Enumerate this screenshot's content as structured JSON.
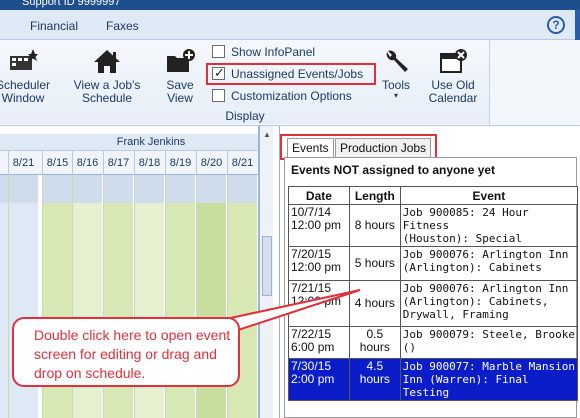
{
  "window": {
    "title": "Support ID 9999997"
  },
  "menu": {
    "items": [
      "Financial",
      "Faxes"
    ]
  },
  "ribbon": {
    "buttons": [
      {
        "label": "Scheduler\nWindow",
        "icon": "scheduler-icon"
      },
      {
        "label": "View a Job's\nSchedule",
        "icon": "house-icon"
      },
      {
        "label": "Save\nView",
        "icon": "save-view-icon"
      },
      {
        "label": "Tools",
        "icon": "wrench-icon"
      },
      {
        "label": "Use Old\nCalendar",
        "icon": "old-calendar-icon"
      }
    ],
    "options": [
      {
        "label": "Show InfoPanel",
        "checked": false
      },
      {
        "label": "Unassigned Events/Jobs",
        "checked": true
      },
      {
        "label": "Customization Options",
        "checked": false
      }
    ],
    "group_label": "Display"
  },
  "schedule": {
    "technician": "Frank Jenkins",
    "dates_left": [
      "8/",
      "8/21"
    ],
    "dates": [
      "8/15",
      "8/16",
      "8/17",
      "8/18",
      "8/19",
      "8/20",
      "8/21"
    ]
  },
  "panel": {
    "tabs": [
      "Events",
      "Production Jobs"
    ],
    "title": "Events NOT assigned to anyone yet",
    "columns": [
      "Date",
      "Length",
      "Event"
    ],
    "rows": [
      {
        "date": "10/7/14\n12:00 pm",
        "length": "8 hours",
        "event": "Job 900085: 24 Hour Fitness\n(Houston): Special",
        "selected": false
      },
      {
        "date": "7/20/15\n12:00 pm",
        "length": "5 hours",
        "event": "Job 900076: Arlington Inn\n(Arlington): Cabinets",
        "selected": false
      },
      {
        "date": "7/21/15\n12:00 pm",
        "length": "4 hours",
        "event": "Job 900076: Arlington Inn\n(Arlington): Cabinets,\nDrywall, Framing",
        "selected": false
      },
      {
        "date": "7/22/15\n6:00 pm",
        "length": "0.5\nhours",
        "event": "Job 900079: Steele, Brooke\n()",
        "selected": false
      },
      {
        "date": "7/30/15\n2:00 pm",
        "length": "4.5\nhours",
        "event": "Job 900077: Marble Mansion\nInn (Warren): Final Testing",
        "selected": true
      }
    ]
  },
  "callout": {
    "text": "Double click here to open event screen for editing or drag and drop on schedule."
  },
  "colors": {
    "accent": "#e0303a",
    "selection": "#0b1cc9",
    "schedule_green": "#d7e8b5"
  }
}
